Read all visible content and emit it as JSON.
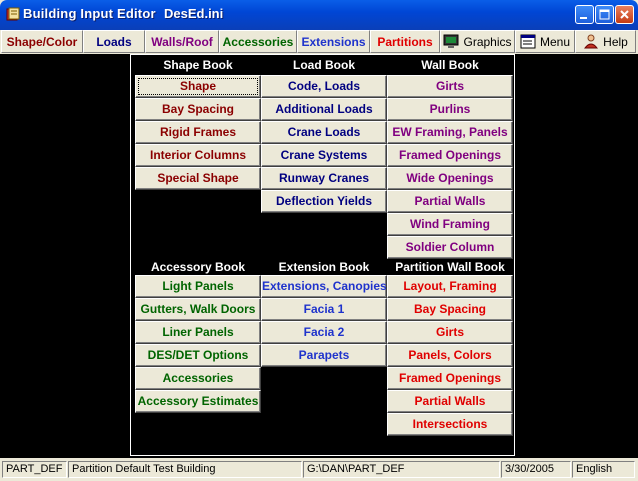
{
  "window": {
    "app_title": "Building Input Editor",
    "file_name": "DesEd.ini"
  },
  "toolbar": {
    "shape_color": "Shape/Color",
    "loads": "Loads",
    "walls_roof": "Walls/Roof",
    "accessories": "Accessories",
    "extensions": "Extensions",
    "partitions": "Partitions",
    "graphics": "Graphics",
    "menu": "Menu",
    "help": "Help"
  },
  "shape_book": {
    "title": "Shape Book",
    "items": [
      "Shape",
      "Bay Spacing",
      "Rigid Frames",
      "Interior Columns",
      "Special Shape"
    ]
  },
  "load_book": {
    "title": "Load Book",
    "items": [
      "Code, Loads",
      "Additional Loads",
      "Crane Loads",
      "Crane Systems",
      "Runway Cranes",
      "Deflection Yields"
    ]
  },
  "wall_book": {
    "title": "Wall Book",
    "items": [
      "Girts",
      "Purlins",
      "EW Framing, Panels",
      "Framed Openings",
      "Wide Openings",
      "Partial Walls",
      "Wind Framing",
      "Soldier Column"
    ]
  },
  "accessory_book": {
    "title": "Accessory Book",
    "items": [
      "Light Panels",
      "Gutters, Walk Doors",
      "Liner Panels",
      "DES/DET Options",
      "Accessories",
      "Accessory Estimates"
    ]
  },
  "extension_book": {
    "title": "Extension Book",
    "items": [
      "Extensions, Canopies",
      "Facia 1",
      "Facia 2",
      "Parapets"
    ]
  },
  "partition_wall_book": {
    "title": "Partition Wall Book",
    "items": [
      "Layout, Framing",
      "Bay Spacing",
      "Girts",
      "Panels, Colors",
      "Framed Openings",
      "Partial Walls",
      "Intersections"
    ]
  },
  "status": {
    "code": "PART_DEF",
    "description": "Partition Default Test Building",
    "path": "G:\\DAN\\PART_DEF",
    "date": "3/30/2005",
    "language": "English"
  },
  "colors": {
    "shape": "#8b0000",
    "load": "#000080",
    "wall": "#800080",
    "accessory": "#006400",
    "extension": "#1f33cc",
    "partition": "#e00000"
  }
}
